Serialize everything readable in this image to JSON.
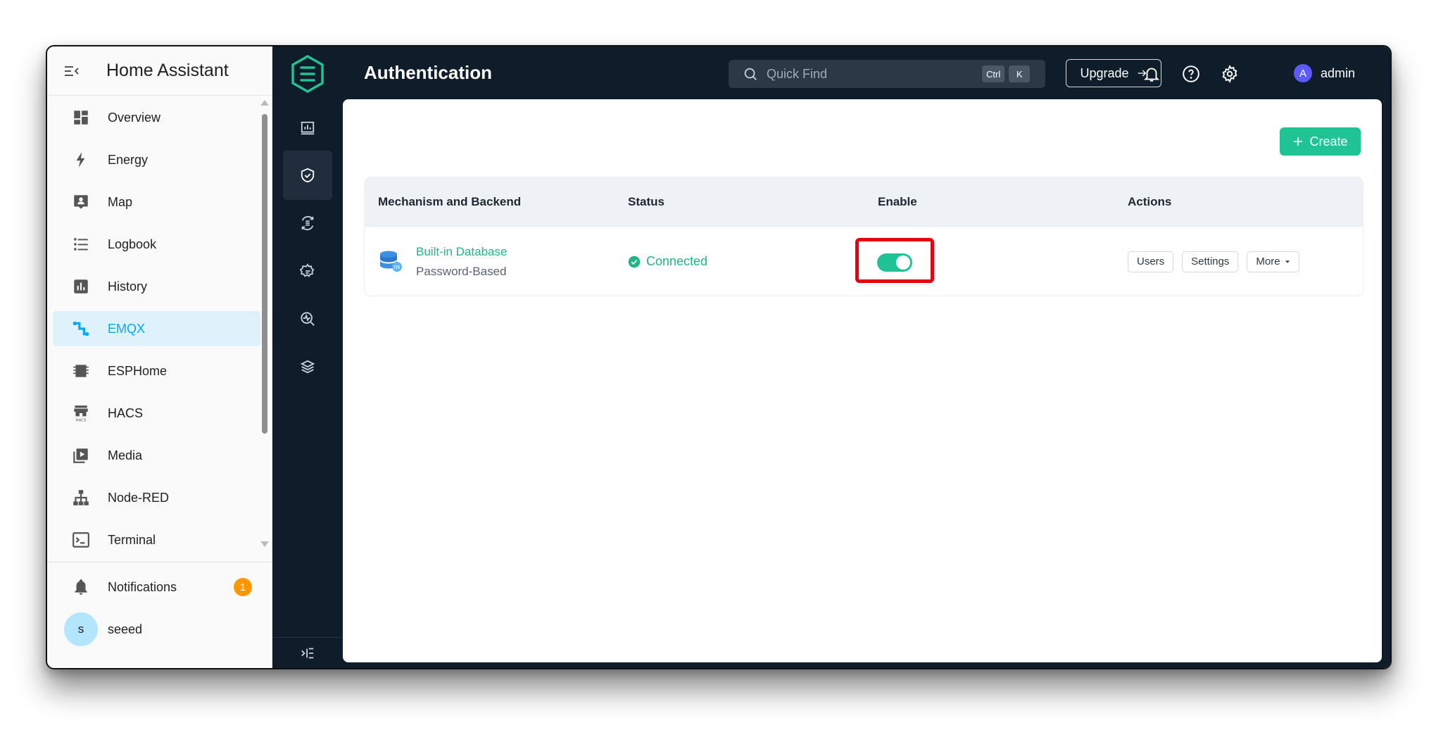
{
  "ha": {
    "title": "Home Assistant",
    "items": [
      {
        "label": "Overview",
        "icon": "dashboard-icon"
      },
      {
        "label": "Energy",
        "icon": "lightning-icon"
      },
      {
        "label": "Map",
        "icon": "map-person-icon"
      },
      {
        "label": "Logbook",
        "icon": "list-icon"
      },
      {
        "label": "History",
        "icon": "bar-chart-icon"
      },
      {
        "label": "EMQX",
        "icon": "emqx-pipe-icon"
      },
      {
        "label": "ESPHome",
        "icon": "chip-icon"
      },
      {
        "label": "HACS",
        "icon": "hacs-store-icon"
      },
      {
        "label": "Media",
        "icon": "play-library-icon"
      },
      {
        "label": "Node-RED",
        "icon": "sitemap-icon"
      },
      {
        "label": "Terminal",
        "icon": "terminal-icon"
      }
    ],
    "notifications": {
      "label": "Notifications",
      "count": "1"
    },
    "user": {
      "label": "seeed",
      "initial": "s"
    }
  },
  "emqx": {
    "page_title": "Authentication",
    "search": {
      "placeholder": "Quick Find",
      "key1": "Ctrl",
      "key2": "K"
    },
    "upgrade_label": "Upgrade",
    "user": {
      "initial": "A",
      "name": "admin"
    },
    "create_label": "Create",
    "table": {
      "headers": [
        "Mechanism and Backend",
        "Status",
        "Enable",
        "Actions"
      ],
      "rows": [
        {
          "name": "Built-in Database",
          "subtitle": "Password-Based",
          "status": "Connected",
          "enabled": true,
          "actions": [
            "Users",
            "Settings",
            "More"
          ]
        }
      ]
    }
  },
  "colors": {
    "accent": "#1fc394",
    "ha_active": "#03a9f4",
    "dark_bg": "#0f1d2b",
    "highlight": "#e8000f"
  }
}
